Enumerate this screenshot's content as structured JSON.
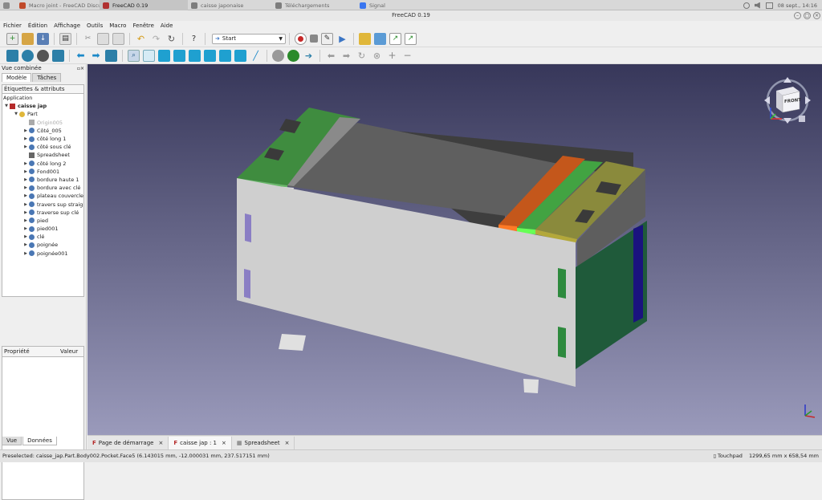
{
  "taskbar": {
    "items": [
      "Macro joint - FreeCAD Discu...",
      "FreeCAD 0.19",
      "caisse japonaise",
      "Téléchargements",
      "Signal"
    ],
    "datetime": "08 sept., 14:16"
  },
  "window": {
    "title": "FreeCAD 0.19"
  },
  "menu": [
    "Fichier",
    "Édition",
    "Affichage",
    "Outils",
    "Macro",
    "Fenêtre",
    "Aide"
  ],
  "toolbar": {
    "workbench": "Start"
  },
  "combo": {
    "title": "Vue combinée",
    "tabs": [
      "Modèle",
      "Tâches"
    ],
    "labels_header": "Étiquettes & attributs",
    "application": "Application",
    "tree": [
      {
        "label": "caisse jap",
        "level": 0,
        "expanded": true,
        "bold": true,
        "icon": "document-icon"
      },
      {
        "label": "Part",
        "level": 1,
        "expanded": true,
        "icon": "part-icon"
      },
      {
        "label": "Origin005",
        "level": 2,
        "hidden": true,
        "icon": "origin-icon"
      },
      {
        "label": "Côté_005",
        "level": 2,
        "icon": "body-icon"
      },
      {
        "label": "côté long 1",
        "level": 2,
        "icon": "body-icon"
      },
      {
        "label": "côté sous clé",
        "level": 2,
        "icon": "body-icon"
      },
      {
        "label": "Spreadsheet",
        "level": 2,
        "icon": "spreadsheet-icon"
      },
      {
        "label": "côté long 2",
        "level": 2,
        "icon": "body-icon"
      },
      {
        "label": "Fond001",
        "level": 2,
        "icon": "body-icon"
      },
      {
        "label": "bordure haute 1",
        "level": 2,
        "icon": "body-icon"
      },
      {
        "label": "bordure avec clé",
        "level": 2,
        "icon": "body-icon"
      },
      {
        "label": "plateau couvercle",
        "level": 2,
        "icon": "body-icon"
      },
      {
        "label": "travers sup straight",
        "level": 2,
        "icon": "body-icon"
      },
      {
        "label": "traverse sup clé",
        "level": 2,
        "icon": "body-icon"
      },
      {
        "label": "pied",
        "level": 2,
        "icon": "body-icon"
      },
      {
        "label": "pied001",
        "level": 2,
        "icon": "body-icon"
      },
      {
        "label": "clé",
        "level": 2,
        "icon": "body-icon"
      },
      {
        "label": "poignée",
        "level": 2,
        "icon": "body-icon"
      },
      {
        "label": "poignée001",
        "level": 2,
        "icon": "body-icon"
      }
    ],
    "property_col": "Propriété",
    "value_col": "Valeur",
    "bottom_tabs": [
      "Vue",
      "Données"
    ]
  },
  "navcube": {
    "face": "FRONT"
  },
  "doc_tabs": [
    "Page de démarrage",
    "caisse jap : 1",
    "Spreadsheet"
  ],
  "status": {
    "preselected": "Preselected: caisse_jap.Part.Body002.Pocket.Face5 (6.143015 mm, -12.000031 mm, 237.517151 mm)",
    "nav_style": "Touchpad",
    "dimensions": "1299,65 mm x 658,54 mm"
  },
  "colors": {
    "accent": "#3b75c4",
    "viewport_top": "#37375a",
    "viewport_bottom": "#9a9abb"
  }
}
